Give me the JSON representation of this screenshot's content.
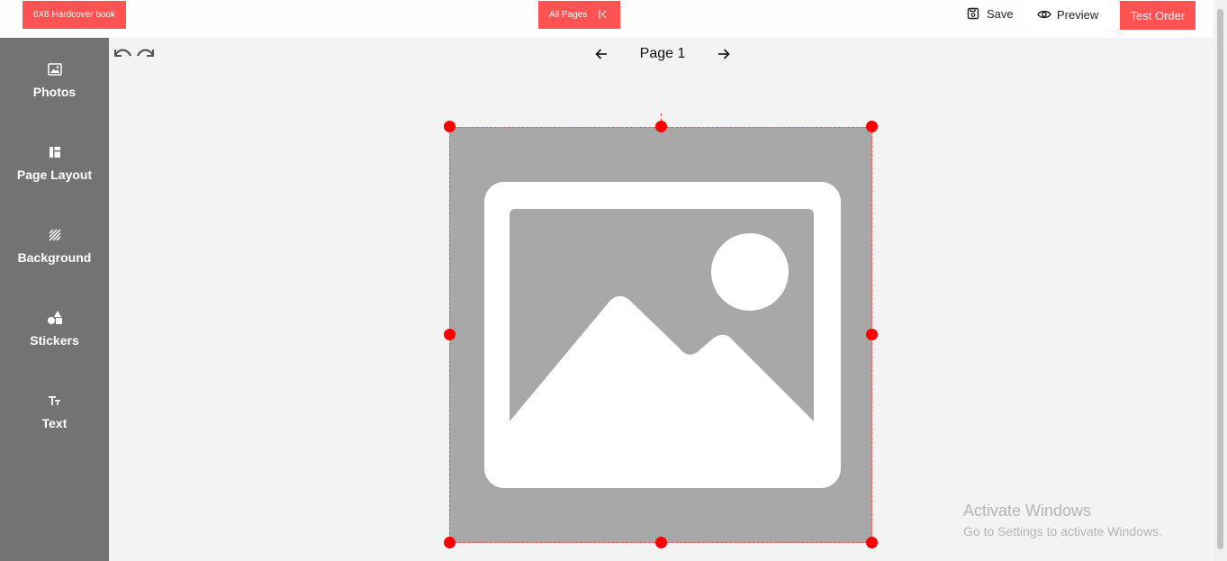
{
  "header": {
    "product_label": "6X6 Hardcover book",
    "all_pages_label": "All Pages",
    "save_label": "Save",
    "preview_label": "Preview",
    "test_order_label": "Test Order"
  },
  "sidebar": {
    "items": [
      {
        "label": "Photos",
        "icon": "image-icon"
      },
      {
        "label": "Page Layout",
        "icon": "layout-icon"
      },
      {
        "label": "Background",
        "icon": "hatch-pattern-icon"
      },
      {
        "label": "Stickers",
        "icon": "shapes-icon"
      },
      {
        "label": "Text",
        "icon": "text-size-icon"
      }
    ]
  },
  "pager": {
    "label": "Page 1"
  },
  "watermark": {
    "line1": "Activate Windows",
    "line2": "Go to Settings to activate Windows."
  },
  "colors": {
    "accent": "#ff5252",
    "sidebar": "#737373",
    "handle": "#ff0000",
    "placeholder": "#a8a8a8"
  }
}
